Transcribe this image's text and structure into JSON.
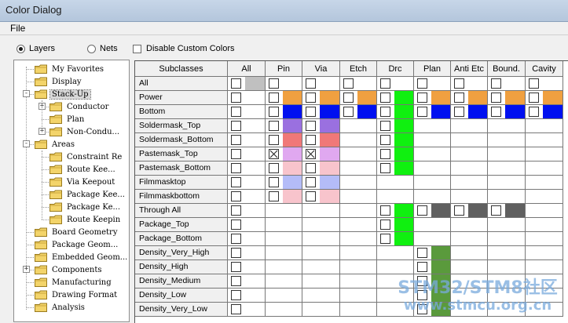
{
  "window": {
    "title": "Color Dialog"
  },
  "menu": {
    "file": "File"
  },
  "options": {
    "layers": "Layers",
    "nets": "Nets",
    "disable_custom": "Disable Custom Colors",
    "selected": "layers"
  },
  "tree": [
    {
      "label": "My Favorites",
      "level": 0
    },
    {
      "label": "Display",
      "level": 0
    },
    {
      "label": "Stack-Up",
      "level": 0,
      "expander": "-",
      "selected": true
    },
    {
      "label": "Conductor",
      "level": 1,
      "expander": "+"
    },
    {
      "label": "Plan",
      "level": 1
    },
    {
      "label": "Non-Condu...",
      "level": 1,
      "expander": "+"
    },
    {
      "label": "Areas",
      "level": 0,
      "expander": "-"
    },
    {
      "label": "Constraint Re",
      "level": 1
    },
    {
      "label": "Route Kee...",
      "level": 1
    },
    {
      "label": "Via Keepout",
      "level": 1
    },
    {
      "label": "Package Kee...",
      "level": 1
    },
    {
      "label": "Package Ke...",
      "level": 1
    },
    {
      "label": "Route Keepin",
      "level": 1
    },
    {
      "label": "Board Geometry",
      "level": 0
    },
    {
      "label": "Package Geom...",
      "level": 0
    },
    {
      "label": "Embedded Geom...",
      "level": 0
    },
    {
      "label": "Components",
      "level": 0,
      "expander": "+"
    },
    {
      "label": "Manufacturing",
      "level": 0
    },
    {
      "label": "Drawing Format",
      "level": 0
    },
    {
      "label": "Analysis",
      "level": 0
    }
  ],
  "grid": {
    "corner": "Subclasses",
    "columns": [
      "All",
      "Pin",
      "Via",
      "Etch",
      "Drc",
      "Plan",
      "Anti Etc",
      "Bound.",
      "Cavity"
    ],
    "colors": {
      "g": "#c0c0c0",
      "o": "#f0a040",
      "b": "#0010f0",
      "p": "#9a70e0",
      "r": "#f07878",
      "m": "#e0a8f0",
      "k": "#f8c4cc",
      "l": "#b4bcf8",
      "n": "#10f010",
      "d": "#606060",
      "v": "#5a9a3c"
    },
    "rows": [
      {
        "name": "All",
        "cells": [
          {
            "c": 1,
            "s": "g"
          },
          {
            "c": 1
          },
          {
            "c": 1
          },
          {
            "c": 1
          },
          {
            "c": 1
          },
          {
            "c": 1
          },
          {
            "c": 1
          },
          {
            "c": 1
          },
          {
            "c": 1
          }
        ]
      },
      {
        "name": "Power",
        "cells": [
          {
            "c": 1
          },
          {
            "c": 1,
            "s": "o"
          },
          {
            "c": 1,
            "s": "o"
          },
          {
            "c": 1,
            "s": "o"
          },
          {
            "c": 1,
            "s": "n"
          },
          {
            "c": 1,
            "s": "o"
          },
          {
            "c": 1,
            "s": "o"
          },
          {
            "c": 1,
            "s": "o"
          },
          {
            "c": 1,
            "s": "o"
          }
        ]
      },
      {
        "name": "Bottom",
        "cells": [
          {
            "c": 1
          },
          {
            "c": 1,
            "s": "b"
          },
          {
            "c": 1,
            "s": "b"
          },
          {
            "c": 1,
            "s": "b"
          },
          {
            "c": 1,
            "s": "n"
          },
          {
            "c": 1,
            "s": "b"
          },
          {
            "c": 1,
            "s": "b"
          },
          {
            "c": 1,
            "s": "b"
          },
          {
            "c": 1,
            "s": "b"
          }
        ]
      },
      {
        "name": "Soldermask_Top",
        "cells": [
          {
            "c": 1
          },
          {
            "c": 1,
            "s": "p"
          },
          {
            "c": 1,
            "s": "p"
          },
          {},
          {
            "c": 1,
            "s": "n"
          },
          {},
          {},
          {},
          {}
        ]
      },
      {
        "name": "Soldermask_Bottom",
        "cells": [
          {
            "c": 1
          },
          {
            "c": 1,
            "s": "r"
          },
          {
            "c": 1,
            "s": "r"
          },
          {},
          {
            "c": 1,
            "s": "n"
          },
          {},
          {},
          {},
          {}
        ]
      },
      {
        "name": "Pastemask_Top",
        "cells": [
          {
            "c": 1
          },
          {
            "c": 1,
            "x": 1,
            "s": "m"
          },
          {
            "c": 1,
            "x": 1,
            "s": "m"
          },
          {},
          {
            "c": 1,
            "s": "n"
          },
          {},
          {},
          {},
          {}
        ]
      },
      {
        "name": "Pastemask_Bottom",
        "cells": [
          {
            "c": 1
          },
          {
            "c": 1,
            "s": "k"
          },
          {
            "c": 1,
            "s": "k"
          },
          {},
          {
            "c": 1,
            "s": "n"
          },
          {},
          {},
          {},
          {}
        ]
      },
      {
        "name": "Filmmasktop",
        "cells": [
          {
            "c": 1
          },
          {
            "c": 1,
            "s": "l"
          },
          {
            "c": 1,
            "s": "l"
          },
          {},
          {},
          {},
          {},
          {},
          {}
        ]
      },
      {
        "name": "Filmmaskbottom",
        "cells": [
          {
            "c": 1
          },
          {
            "c": 1,
            "s": "k"
          },
          {
            "c": 1,
            "s": "k"
          },
          {},
          {},
          {},
          {},
          {},
          {}
        ]
      },
      {
        "name": "Through All",
        "cells": [
          {
            "c": 1
          },
          {},
          {},
          {},
          {
            "c": 1,
            "s": "n"
          },
          {
            "c": 1,
            "s": "d"
          },
          {
            "c": 1,
            "s": "d"
          },
          {
            "c": 1,
            "s": "d"
          },
          {}
        ]
      },
      {
        "name": "Package_Top",
        "cells": [
          {
            "c": 1
          },
          {},
          {},
          {},
          {
            "c": 1,
            "s": "n"
          },
          {},
          {},
          {},
          {}
        ]
      },
      {
        "name": "Package_Bottom",
        "cells": [
          {
            "c": 1
          },
          {},
          {},
          {},
          {
            "c": 1,
            "s": "n"
          },
          {},
          {},
          {},
          {}
        ]
      },
      {
        "name": "Density_Very_High",
        "cells": [
          {
            "c": 1
          },
          {},
          {},
          {},
          {},
          {
            "c": 1,
            "s": "v"
          },
          {},
          {},
          {}
        ]
      },
      {
        "name": "Density_High",
        "cells": [
          {
            "c": 1
          },
          {},
          {},
          {},
          {},
          {
            "c": 1,
            "s": "v"
          },
          {},
          {},
          {}
        ]
      },
      {
        "name": "Density_Medium",
        "cells": [
          {
            "c": 1
          },
          {},
          {},
          {},
          {},
          {
            "c": 1,
            "s": "v"
          },
          {},
          {},
          {}
        ]
      },
      {
        "name": "Density_Low",
        "cells": [
          {
            "c": 1
          },
          {},
          {},
          {},
          {},
          {
            "c": 1,
            "s": "v"
          },
          {},
          {},
          {}
        ]
      },
      {
        "name": "Density_Very_Low",
        "cells": [
          {
            "c": 1
          },
          {},
          {},
          {},
          {},
          {
            "c": 1,
            "s": "v"
          },
          {},
          {},
          {}
        ]
      }
    ]
  },
  "watermark": {
    "line1": "STM32/STM8社区",
    "line2": "www.stmcu.org.cn"
  }
}
